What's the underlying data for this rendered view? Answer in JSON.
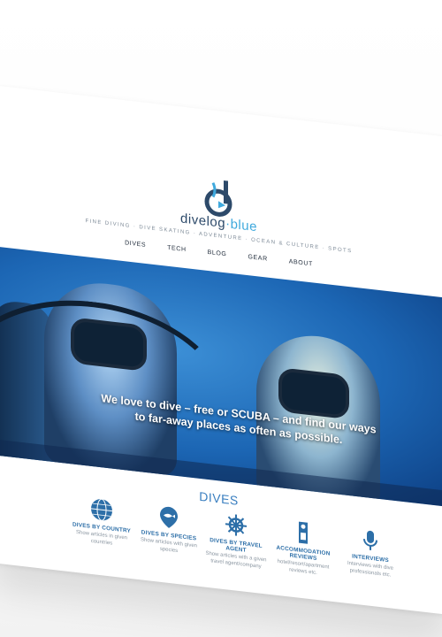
{
  "site": {
    "brand_part1": "divelog",
    "brand_part2": "blue",
    "tagline": "Fine diving · Dive Skating · Adventure · Ocean & Culture · Spots",
    "logo_icon": "dive-logo-icon"
  },
  "nav": {
    "items": [
      "DIVES",
      "TECH",
      "BLOG",
      "GEAR",
      "ABOUT"
    ]
  },
  "hero": {
    "caption": "We love to dive – free or SCUBA – and find our ways to far-away places as often as possible."
  },
  "dives": {
    "title": "DIVES",
    "categories": [
      {
        "title": "DIVES BY COUNTRY",
        "desc": "Show articles in given countries",
        "icon": "globe-icon"
      },
      {
        "title": "DIVES BY SPECIES",
        "desc": "Show articles with given species",
        "icon": "fish-pin-icon"
      },
      {
        "title": "DIVES BY TRAVEL AGENT",
        "desc": "Show articles with a given travel agent/company",
        "icon": "ship-wheel-icon"
      },
      {
        "title": "ACCOMMODATION REVIEWS",
        "desc": "hotel/resort/apartment reviews etc.",
        "icon": "door-hanger-icon"
      },
      {
        "title": "INTERVIEWS",
        "desc": "Interviews with dive professionals etc.",
        "icon": "microphone-icon"
      }
    ]
  },
  "colors": {
    "accent": "#3a7fc0",
    "brand_dark": "#2d4a6a",
    "brand_blue": "#3fa9dd"
  }
}
